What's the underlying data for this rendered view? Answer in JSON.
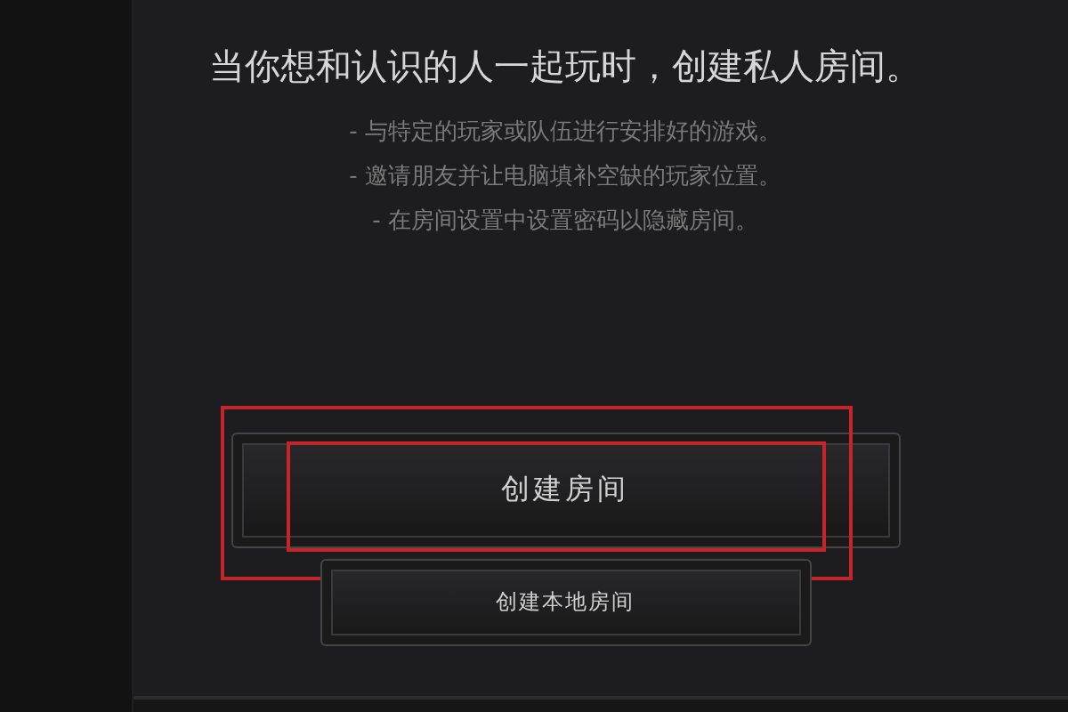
{
  "heading": "当你想和认识的人一起玩时，创建私人房间。",
  "bullets": [
    "- 与特定的玩家或队伍进行安排好的游戏。",
    "- 邀请朋友并让电脑填补空缺的玩家位置。",
    "- 在房间设置中设置密码以隐藏房间。"
  ],
  "buttons": [
    {
      "label": "创建房间",
      "kind": "primary",
      "highlighted": true
    },
    {
      "label": "创建本地房间",
      "kind": "secondary",
      "highlighted": false
    }
  ]
}
